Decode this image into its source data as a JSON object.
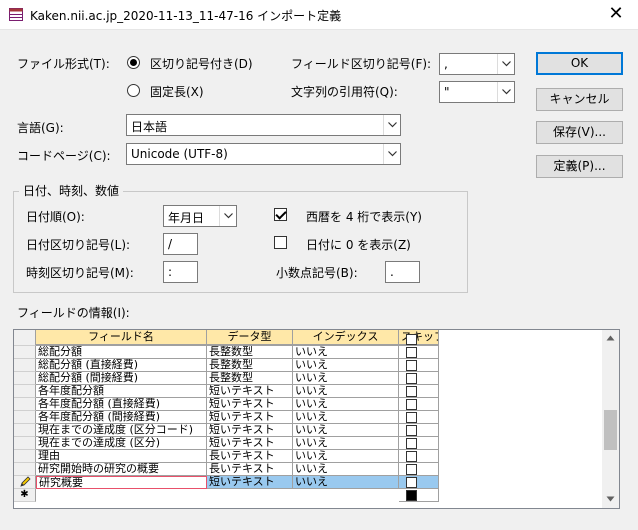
{
  "window": {
    "title": "Kaken.nii.ac.jp_2020-11-13_11-47-16 インポート定義",
    "close_glyph": "✕"
  },
  "file_format": {
    "label": "ファイル形式(T):",
    "delimited": {
      "label": "区切り記号付き(D)",
      "selected": true
    },
    "fixed": {
      "label": "固定長(X)",
      "selected": false
    }
  },
  "field_delimiter": {
    "label": "フィールド区切り記号(F):",
    "value": ","
  },
  "text_qualifier": {
    "label": "文字列の引用符(Q):",
    "value": "\""
  },
  "language": {
    "label": "言語(G):",
    "value": "日本語"
  },
  "code_page": {
    "label": "コードページ(C):",
    "value": "Unicode (UTF-8)"
  },
  "buttons": {
    "ok": "OK",
    "cancel": "キャンセル",
    "save": "保存(V)...",
    "specs": "定義(P)..."
  },
  "datetime": {
    "group_title": "日付、時刻、数値",
    "date_order": {
      "label": "日付順(O):",
      "value": "年月日"
    },
    "date_delimiter": {
      "label": "日付区切り記号(L):",
      "value": "/"
    },
    "time_delimiter": {
      "label": "時刻区切り記号(M):",
      "value": ":"
    },
    "four_digit_years": {
      "label": "西暦を 4 桁で表示(Y)",
      "checked": true
    },
    "leading_zeros": {
      "label": "日付に 0 を表示(Z)",
      "checked": false
    },
    "decimal_symbol": {
      "label": "小数点記号(B):",
      "value": "."
    }
  },
  "field_info": {
    "label": "フィールドの情報(I):",
    "columns": [
      "フィールド名",
      "データ型",
      "インデックス",
      "スキップ"
    ],
    "rows": [
      {
        "name": "",
        "type": "",
        "index": "",
        "skip": false
      },
      {
        "name": "総配分額",
        "type": "長整数型",
        "index": "いいえ",
        "skip": false
      },
      {
        "name": "総配分額 (直接経費)",
        "type": "長整数型",
        "index": "いいえ",
        "skip": false
      },
      {
        "name": "総配分額 (間接経費)",
        "type": "長整数型",
        "index": "いいえ",
        "skip": false
      },
      {
        "name": "各年度配分額",
        "type": "短いテキスト",
        "index": "いいえ",
        "skip": false
      },
      {
        "name": "各年度配分額 (直接経費)",
        "type": "短いテキスト",
        "index": "いいえ",
        "skip": false
      },
      {
        "name": "各年度配分額 (間接経費)",
        "type": "短いテキスト",
        "index": "いいえ",
        "skip": false
      },
      {
        "name": "現在までの達成度 (区分コード)",
        "type": "短いテキスト",
        "index": "いいえ",
        "skip": false
      },
      {
        "name": "現在までの達成度 (区分)",
        "type": "短いテキスト",
        "index": "いいえ",
        "skip": false
      },
      {
        "name": "理由",
        "type": "長いテキスト",
        "index": "いいえ",
        "skip": false
      },
      {
        "name": "研究開始時の研究の概要",
        "type": "長いテキスト",
        "index": "いいえ",
        "skip": false
      },
      {
        "name": "研究概要",
        "type": "短いテキスト",
        "index": "いいえ",
        "skip": false,
        "editing": true
      }
    ],
    "new_row_glyph": "✱"
  },
  "colors": {
    "header_bg": "#ffe8a8",
    "selection": "#99c9ef",
    "accent": "#0078d7"
  }
}
